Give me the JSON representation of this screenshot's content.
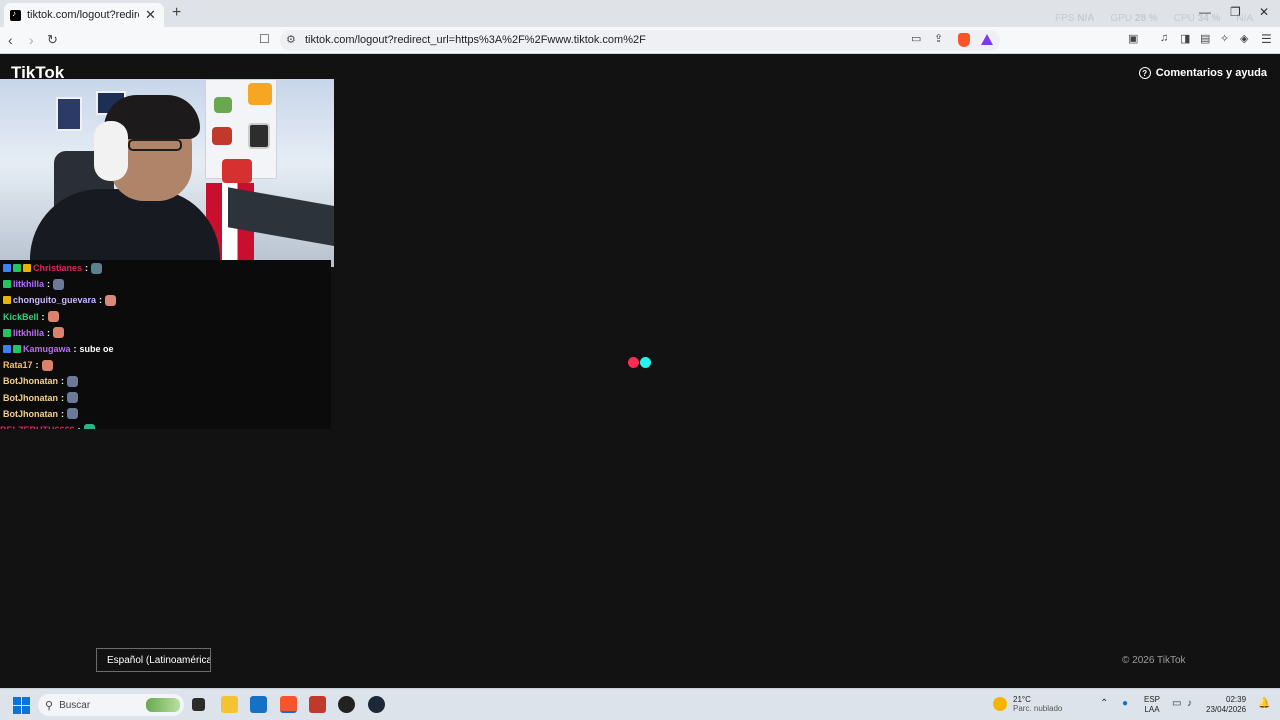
{
  "browser": {
    "tab_title": "tiktok.com/logout?redirect_url=h",
    "url": "tiktok.com/logout?redirect_url=https%3A%2F%2Fwww.tiktok.com%2F",
    "perf": {
      "fps_label": "FPS",
      "fps_value": "N/A",
      "gpu_label": "GPU",
      "gpu_value": "28 %",
      "cpu_label": "CPU",
      "cpu_value": "34 %",
      "extra_label": "N/A"
    }
  },
  "page": {
    "logo": "TikTok",
    "help_label": "Comentarios y ayuda",
    "language_button": "Español (Latinoamérica)",
    "copyright": "© 2026 TikTok",
    "colors": {
      "loader_red": "#fe2c55",
      "loader_cyan": "#25f4ee",
      "background": "#121212"
    }
  },
  "chat": {
    "messages": [
      {
        "user": "Christianes",
        "color": "#e0245e",
        "message": "",
        "badges": [
          "#3b82f6",
          "#22c55e",
          "#eab308"
        ],
        "emote_color": "#5f7f8f"
      },
      {
        "user": "litkhilla",
        "color": "#b86cff",
        "message": "",
        "badges": [
          "#22c55e"
        ],
        "emote_color": "#6b7a99"
      },
      {
        "user": "chonguito_guevara",
        "color": "#c8b7ff",
        "message": "",
        "badges": [
          "#eab308"
        ],
        "emote_color": "#d88a7a"
      },
      {
        "user": "KickBell",
        "color": "#33d17a",
        "message": "",
        "badges": [],
        "emote_color": "#d9826e"
      },
      {
        "user": "litkhilla",
        "color": "#b86cff",
        "message": "",
        "badges": [
          "#22c55e"
        ],
        "emote_color": "#d9826e"
      },
      {
        "user": "Kamugawa",
        "color": "#b86cff",
        "message": "sube oe",
        "badges": [
          "#3b82f6",
          "#22c55e"
        ],
        "emote_color": ""
      },
      {
        "user": "Rata17",
        "color": "#f5c16c",
        "message": "",
        "badges": [],
        "emote_color": "#d9826e"
      },
      {
        "user": "BotJhonatan",
        "color": "#f5d08a",
        "message": "",
        "badges": [],
        "emote_color": "#6b7a99"
      },
      {
        "user": "BotJhonatan",
        "color": "#f5d08a",
        "message": "",
        "badges": [],
        "emote_color": "#6b7a99"
      },
      {
        "user": "BotJhonatan",
        "color": "#f5d08a",
        "message": "",
        "badges": [],
        "emote_color": "#6b7a99"
      },
      {
        "user": "BELZEBUTH6666",
        "color": "#e0245e",
        "message": "",
        "badges": [],
        "emote_color": "#2fb28a"
      }
    ]
  },
  "taskbar": {
    "search_placeholder": "Buscar",
    "weather_temp": "21°C",
    "weather_desc": "Parc. nublado",
    "lang_line1": "ESP",
    "lang_line2": "LAA",
    "time": "02:39",
    "date": "23/04/2026"
  }
}
